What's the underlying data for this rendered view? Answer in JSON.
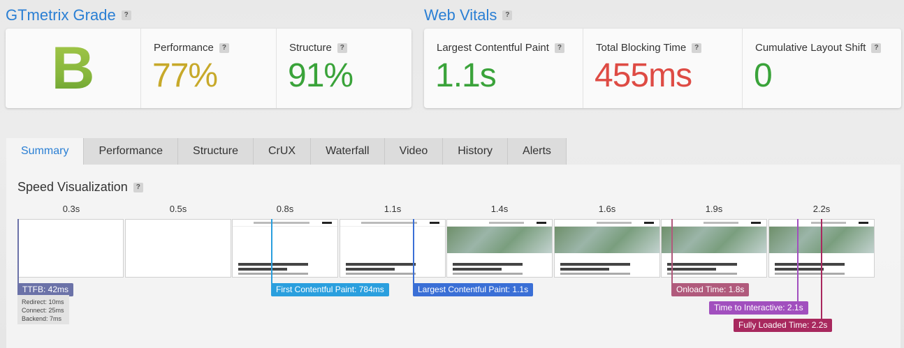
{
  "grade": {
    "title": "GTmetrix Grade",
    "help": "?",
    "letter": "B",
    "performance": {
      "label": "Performance",
      "value": "77%",
      "color": "#c7a92a"
    },
    "structure": {
      "label": "Structure",
      "value": "91%",
      "color": "#3aa33a"
    }
  },
  "vitals": {
    "title": "Web Vitals",
    "help": "?",
    "items": [
      {
        "label": "Largest Contentful Paint",
        "value": "1.1s",
        "color": "#3aa33a"
      },
      {
        "label": "Total Blocking Time",
        "value": "455ms",
        "color": "#de4b44"
      },
      {
        "label": "Cumulative Layout Shift",
        "value": "0",
        "color": "#3aa33a"
      }
    ]
  },
  "tabs": [
    "Summary",
    "Performance",
    "Structure",
    "CrUX",
    "Waterfall",
    "Video",
    "History",
    "Alerts"
  ],
  "active_tab": "Summary",
  "speed": {
    "title": "Speed Visualization",
    "help": "?",
    "times": [
      "0.3s",
      "0.5s",
      "0.8s",
      "1.1s",
      "1.4s",
      "1.6s",
      "1.9s",
      "2.2s"
    ],
    "ttfb": {
      "label": "TTFB: 42ms",
      "redirect": "Redirect: 10ms",
      "connect": "Connect: 25ms",
      "backend": "Backend: 7ms"
    },
    "markers": [
      {
        "label": "First Contentful Paint: 784ms",
        "color": "#2a9fde"
      },
      {
        "label": "Largest Contentful Paint: 1.1s",
        "color": "#3a6fd6"
      },
      {
        "label": "Onload Time: 1.8s",
        "color": "#b05a7c"
      },
      {
        "label": "Time to Interactive: 2.1s",
        "color": "#a14fbe"
      },
      {
        "label": "Fully Loaded Time: 2.2s",
        "color": "#a8285e"
      }
    ],
    "ttfb_color": "#6b72a8"
  }
}
